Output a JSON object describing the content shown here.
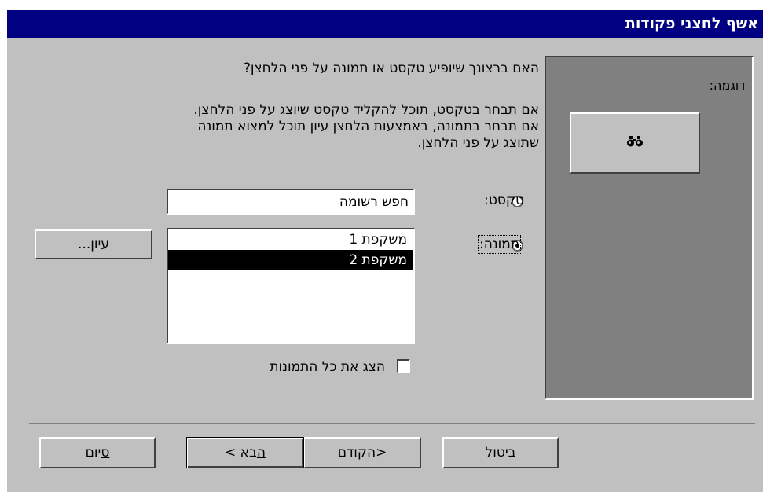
{
  "window": {
    "title": "אשף לחצני פקודות"
  },
  "content": {
    "question": "האם ברצונך שיופיע טקסט או תמונה על פני הלחצן?",
    "info_line1": "אם תבחר בטקסט, תוכל להקליד טקסט שיוצג על פני הלחצן.",
    "info_line2": "אם תבחר בתמונה, באמצעות הלחצן עיון תוכל למצוא תמונה",
    "info_line3": "שתוצג על פני הלחצן."
  },
  "preview": {
    "label": "דוגמה:",
    "icon": "binoculars-icon"
  },
  "text_option": {
    "label": "טקסט:",
    "value": "חפש רשומה",
    "selected": false
  },
  "picture_option": {
    "label": "תמונה:",
    "selected": true,
    "items": [
      "משקפת 1",
      "משקפת 2"
    ],
    "selected_index": 1
  },
  "browse_button": "עיון...",
  "show_all": {
    "label": "הצג את כל התמונות",
    "checked": false
  },
  "buttons": {
    "cancel": "ביטול",
    "back": "<הקודם",
    "next_underlined": "ה",
    "next_rest": "בא >",
    "finish_underlined": "ס",
    "finish_rest": "יום"
  }
}
